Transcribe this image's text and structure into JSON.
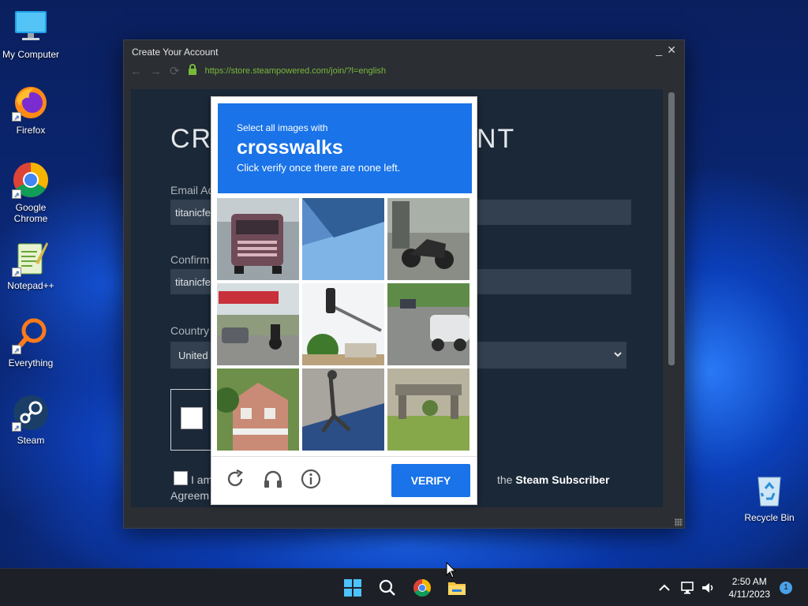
{
  "desktop": {
    "icons": [
      {
        "label": "My Computer",
        "icon": "monitor-icon"
      },
      {
        "label": "Firefox",
        "icon": "firefox-icon"
      },
      {
        "label": "Google Chrome",
        "icon": "chrome-icon"
      },
      {
        "label": "Notepad++",
        "icon": "notepadpp-icon"
      },
      {
        "label": "Everything",
        "icon": "everything-search-icon"
      },
      {
        "label": "Steam",
        "icon": "steam-icon"
      },
      {
        "label": "Recycle Bin",
        "icon": "recycle-bin-icon"
      }
    ]
  },
  "window": {
    "title": "Create Your Account",
    "minimize": "_",
    "close": "✕",
    "url": "https://store.steampowered.com/join/?l=english",
    "page": {
      "heading_left": "CRE",
      "heading_right": "NT",
      "email_label": "Email Ad",
      "email_value": "titanicfe",
      "confirm_label": "Confirm",
      "confirm_value": "titanicfe",
      "country_label": "Country",
      "country_value": "United",
      "agree_prefix": "I am",
      "agree_middle": "the",
      "agree_link": "Steam Subscriber",
      "agree_line2": "Agreem"
    }
  },
  "captcha": {
    "prompt_line1": "Select all images with",
    "prompt_object": "crosswalks",
    "prompt_line3": "Click verify once there are none left.",
    "verify_label": "VERIFY",
    "icons": [
      "reload-icon",
      "headphones-icon",
      "info-icon"
    ]
  },
  "taskbar": {
    "time": "2:50 AM",
    "date": "4/11/2023",
    "notifications": "1"
  },
  "colors": {
    "captcha_blue": "#1a73e8",
    "steam_bg": "#1b2838",
    "url_green": "#79b93a"
  }
}
